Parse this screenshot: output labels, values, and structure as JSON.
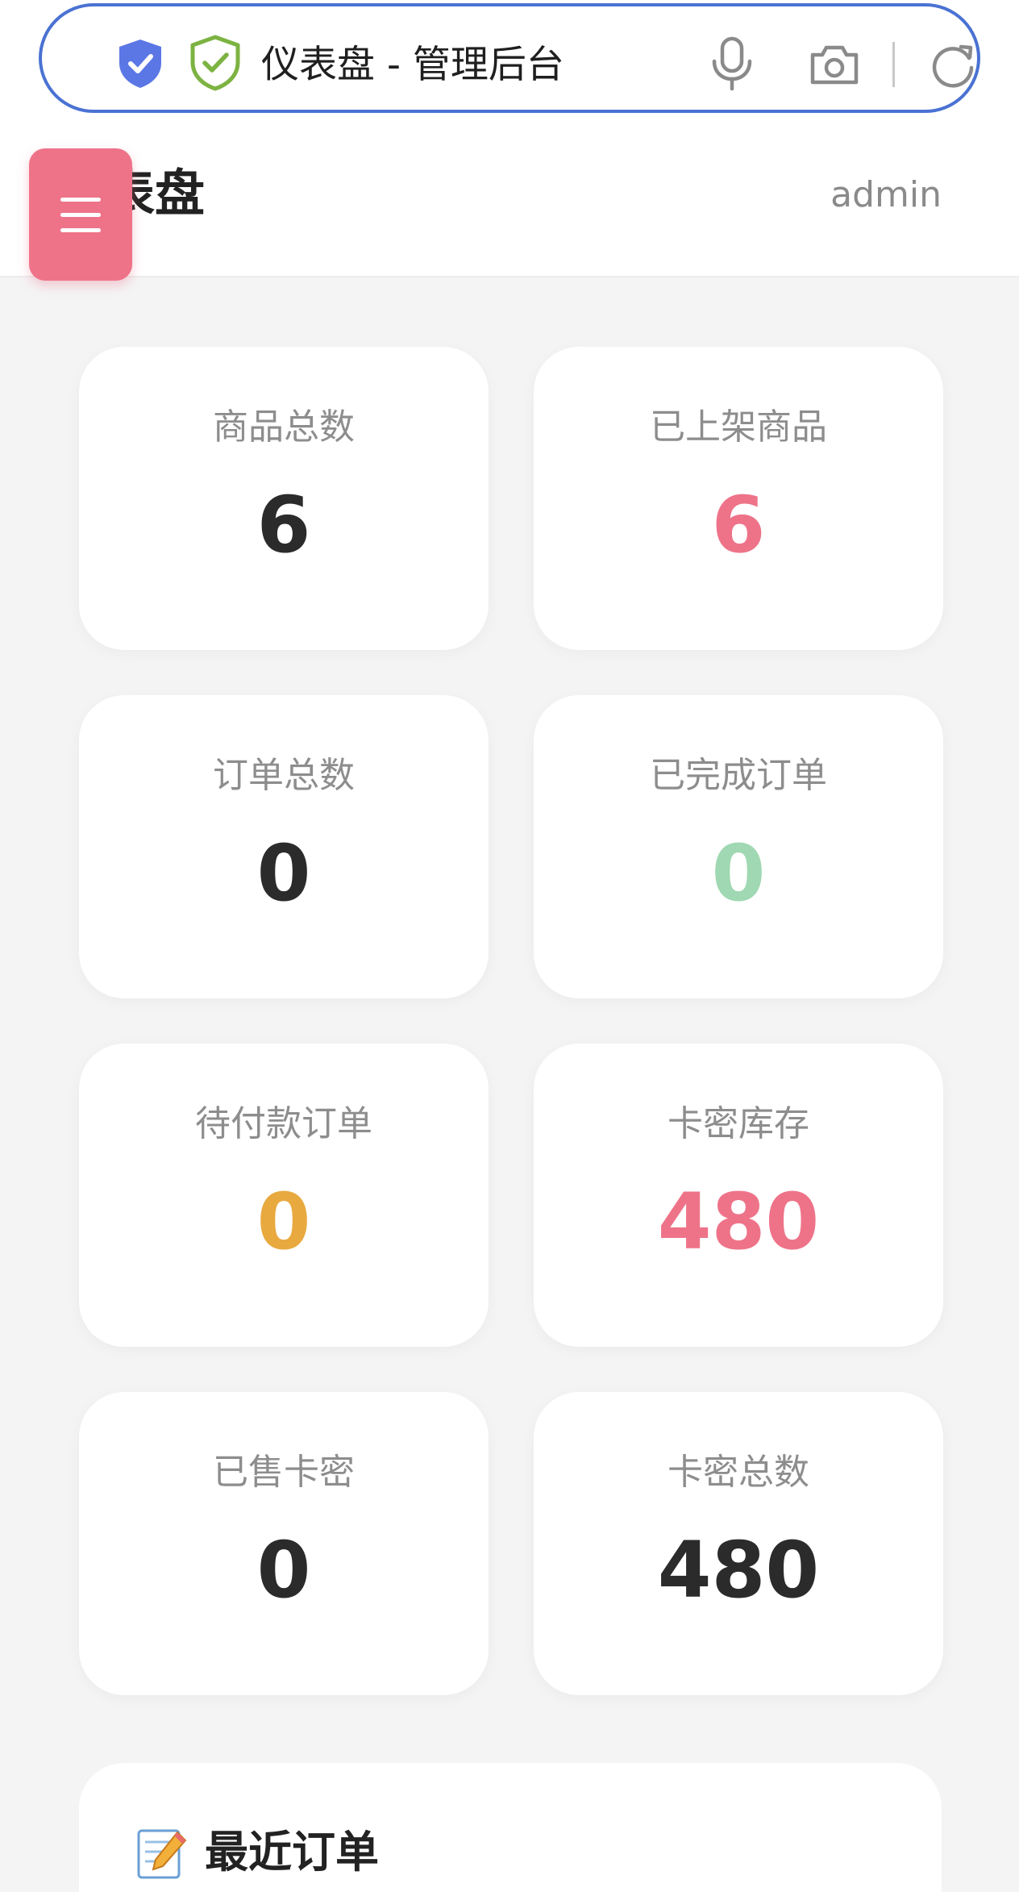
{
  "browser": {
    "tab_title": "仪表盘 - 管理后台"
  },
  "header": {
    "title": "表盘",
    "user": "admin"
  },
  "colors": {
    "accent": "#ee7389",
    "dark": "#2b2b2b",
    "green": "#9fd8b2",
    "orange": "#e8a93f",
    "address_border": "#4a72d3"
  },
  "stats": [
    {
      "label": "商品总数",
      "value": "6",
      "color": "#2b2b2b"
    },
    {
      "label": "已上架商品",
      "value": "6",
      "color": "#ee7389"
    },
    {
      "label": "订单总数",
      "value": "0",
      "color": "#2b2b2b"
    },
    {
      "label": "已完成订单",
      "value": "0",
      "color": "#9fd8b2"
    },
    {
      "label": "待付款订单",
      "value": "0",
      "color": "#e8a93f"
    },
    {
      "label": "卡密库存",
      "value": "480",
      "color": "#ee7389"
    },
    {
      "label": "已售卡密",
      "value": "0",
      "color": "#2b2b2b"
    },
    {
      "label": "卡密总数",
      "value": "480",
      "color": "#2b2b2b"
    }
  ],
  "recent_orders": {
    "icon": "memo-icon",
    "title": "最近订单"
  }
}
